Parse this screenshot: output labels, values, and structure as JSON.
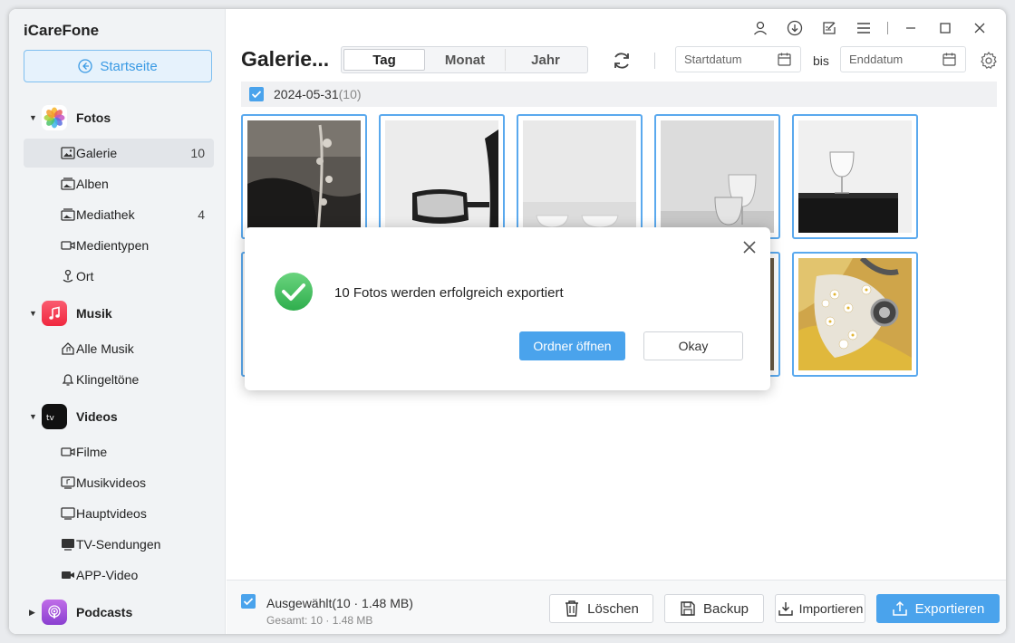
{
  "app": {
    "title": "iCareFone",
    "home_label": "Startseite"
  },
  "sidebar": {
    "categories": [
      {
        "label": "Fotos",
        "items": [
          {
            "label": "Galerie",
            "count": "10"
          },
          {
            "label": "Alben",
            "count": ""
          },
          {
            "label": "Mediathek",
            "count": "4"
          },
          {
            "label": "Medientypen",
            "count": ""
          },
          {
            "label": "Ort",
            "count": ""
          }
        ]
      },
      {
        "label": "Musik",
        "items": [
          {
            "label": "Alle Musik"
          },
          {
            "label": "Klingeltöne"
          }
        ]
      },
      {
        "label": "Videos",
        "items": [
          {
            "label": "Filme"
          },
          {
            "label": "Musikvideos"
          },
          {
            "label": "Hauptvideos"
          },
          {
            "label": "TV-Sendungen"
          },
          {
            "label": "APP-Video"
          }
        ]
      },
      {
        "label": "Podcasts"
      }
    ]
  },
  "header": {
    "title": "Galerie...",
    "tabs": [
      "Tag",
      "Monat",
      "Jahr"
    ],
    "start_placeholder": "Startdatum",
    "bis": "bis",
    "end_placeholder": "Enddatum"
  },
  "content": {
    "date": "2024-05-31",
    "date_count": "(10)"
  },
  "bottom": {
    "selected": "Ausgewählt(10 · 1.48 MB)",
    "total": "Gesamt: 10 · 1.48 MB",
    "delete": "Löschen",
    "backup": "Backup",
    "import": "Importieren",
    "export": "Exportieren"
  },
  "dialog": {
    "message": "10 Fotos werden erfolgreich exportiert",
    "open_folder": "Ordner öffnen",
    "okay": "Okay"
  },
  "colors": {
    "accent": "#4aa3ec",
    "success": "#3fbf5f"
  }
}
